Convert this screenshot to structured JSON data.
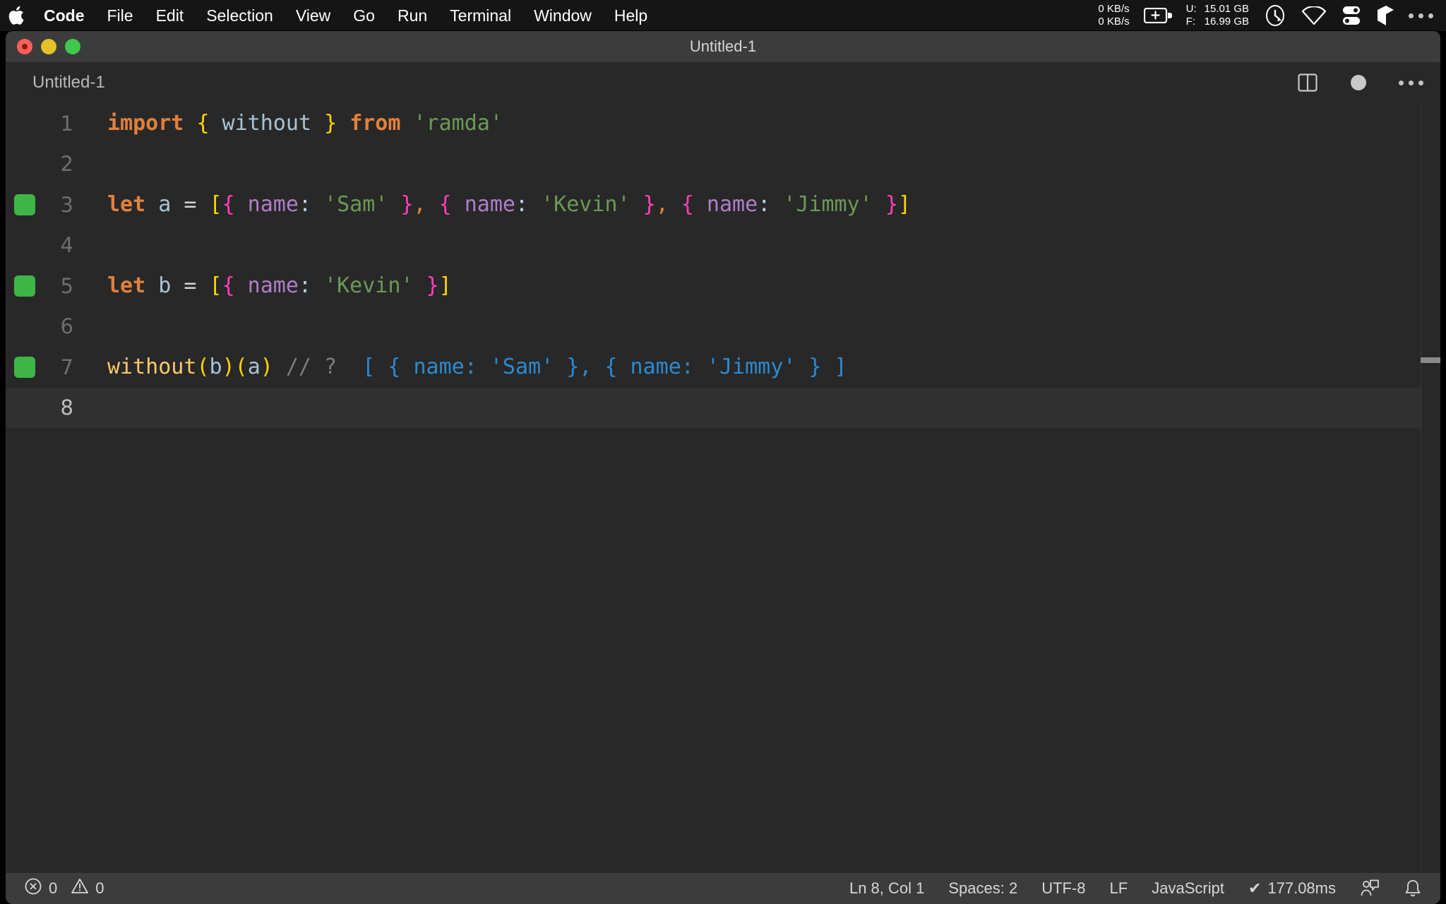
{
  "menubar": {
    "apple_icon": "apple-logo",
    "items": [
      "Code",
      "File",
      "Edit",
      "Selection",
      "View",
      "Go",
      "Run",
      "Terminal",
      "Window",
      "Help"
    ],
    "app_name": "Code",
    "status": {
      "net_up": "0 KB/s",
      "net_down": "0 KB/s",
      "battery_icon": "battery-charging-icon",
      "disk_used_label": "U:",
      "disk_used_value": "15.01 GB",
      "disk_free_label": "F:",
      "disk_free_value": "16.99 GB",
      "clock_icon": "clock-icon",
      "wifi_icon": "wifi-icon",
      "control_center_icon": "control-center-icon",
      "dropbox_icon": "dropbox-icon",
      "more_icon": "ellipsis-icon"
    }
  },
  "window": {
    "title": "Untitled-1",
    "traffic_lights": [
      "close",
      "minimize",
      "maximize"
    ],
    "unsaved": true
  },
  "editor": {
    "tab_label": "Untitled-1",
    "actions": {
      "split_editor": "split-editor-icon",
      "unsaved_dot": "unsaved-dot-icon",
      "more_actions": "ellipsis-icon"
    },
    "current_line": 8,
    "lines": [
      {
        "num": "1",
        "marker": false,
        "tokens": [
          {
            "c": "t-kw",
            "t": "import"
          },
          {
            "c": "t-var",
            "t": " "
          },
          {
            "c": "t-brk1",
            "t": "{"
          },
          {
            "c": "t-var",
            "t": " without "
          },
          {
            "c": "t-brk1",
            "t": "}"
          },
          {
            "c": "t-var",
            "t": " "
          },
          {
            "c": "t-kw",
            "t": "from"
          },
          {
            "c": "t-var",
            "t": " "
          },
          {
            "c": "t-str",
            "t": "'ramda'"
          }
        ]
      },
      {
        "num": "2",
        "marker": false,
        "tokens": []
      },
      {
        "num": "3",
        "marker": true,
        "tokens": [
          {
            "c": "t-kw",
            "t": "let"
          },
          {
            "c": "t-var",
            "t": " a "
          },
          {
            "c": "t-op",
            "t": "="
          },
          {
            "c": "t-var",
            "t": " "
          },
          {
            "c": "t-brk1",
            "t": "["
          },
          {
            "c": "t-brk2",
            "t": "{"
          },
          {
            "c": "t-prop",
            "t": " name"
          },
          {
            "c": "t-colon",
            "t": ":"
          },
          {
            "c": "t-str",
            "t": " 'Sam' "
          },
          {
            "c": "t-brk2",
            "t": "}"
          },
          {
            "c": "t-comma",
            "t": ","
          },
          {
            "c": "t-var",
            "t": " "
          },
          {
            "c": "t-brk2",
            "t": "{"
          },
          {
            "c": "t-prop",
            "t": " name"
          },
          {
            "c": "t-colon",
            "t": ":"
          },
          {
            "c": "t-str",
            "t": " 'Kevin' "
          },
          {
            "c": "t-brk2",
            "t": "}"
          },
          {
            "c": "t-comma",
            "t": ","
          },
          {
            "c": "t-var",
            "t": " "
          },
          {
            "c": "t-brk2",
            "t": "{"
          },
          {
            "c": "t-prop",
            "t": " name"
          },
          {
            "c": "t-colon",
            "t": ":"
          },
          {
            "c": "t-str",
            "t": " 'Jimmy' "
          },
          {
            "c": "t-brk2",
            "t": "}"
          },
          {
            "c": "t-brk1",
            "t": "]"
          }
        ]
      },
      {
        "num": "4",
        "marker": false,
        "tokens": []
      },
      {
        "num": "5",
        "marker": true,
        "tokens": [
          {
            "c": "t-kw",
            "t": "let"
          },
          {
            "c": "t-var",
            "t": " b "
          },
          {
            "c": "t-op",
            "t": "="
          },
          {
            "c": "t-var",
            "t": " "
          },
          {
            "c": "t-brk1",
            "t": "["
          },
          {
            "c": "t-brk2",
            "t": "{"
          },
          {
            "c": "t-prop",
            "t": " name"
          },
          {
            "c": "t-colon",
            "t": ":"
          },
          {
            "c": "t-str",
            "t": " 'Kevin' "
          },
          {
            "c": "t-brk2",
            "t": "}"
          },
          {
            "c": "t-brk1",
            "t": "]"
          }
        ]
      },
      {
        "num": "6",
        "marker": false,
        "tokens": []
      },
      {
        "num": "7",
        "marker": true,
        "tokens": [
          {
            "c": "t-fn",
            "t": "without"
          },
          {
            "c": "t-brk1",
            "t": "("
          },
          {
            "c": "t-var",
            "t": "b"
          },
          {
            "c": "t-brk1",
            "t": ")"
          },
          {
            "c": "t-brk1",
            "t": "("
          },
          {
            "c": "t-var",
            "t": "a"
          },
          {
            "c": "t-brk1",
            "t": ")"
          },
          {
            "c": "t-comment",
            "t": " // ?"
          },
          {
            "c": "t-inline",
            "t": "  [ { name: 'Sam' }, { name: 'Jimmy' } ]"
          }
        ]
      },
      {
        "num": "8",
        "marker": false,
        "tokens": []
      }
    ]
  },
  "statusbar": {
    "error_icon": "error-circle-icon",
    "error_count": "0",
    "warning_icon": "warning-triangle-icon",
    "warning_count": "0",
    "cursor_position": "Ln 8, Col 1",
    "indentation": "Spaces: 2",
    "encoding": "UTF-8",
    "eol": "LF",
    "language": "JavaScript",
    "quokka_check": "✔",
    "quokka_time": "177.08ms",
    "feedback_icon": "feedback-person-icon",
    "bell_icon": "bell-icon"
  },
  "colors": {
    "menubar_bg": "#151515",
    "titlebar_bg": "#3c3c3c",
    "editor_bg": "#282828",
    "statusbar_bg": "#3c3c3c",
    "marker_green": "#3fb548",
    "accent_blue": "#2b8ad1"
  }
}
